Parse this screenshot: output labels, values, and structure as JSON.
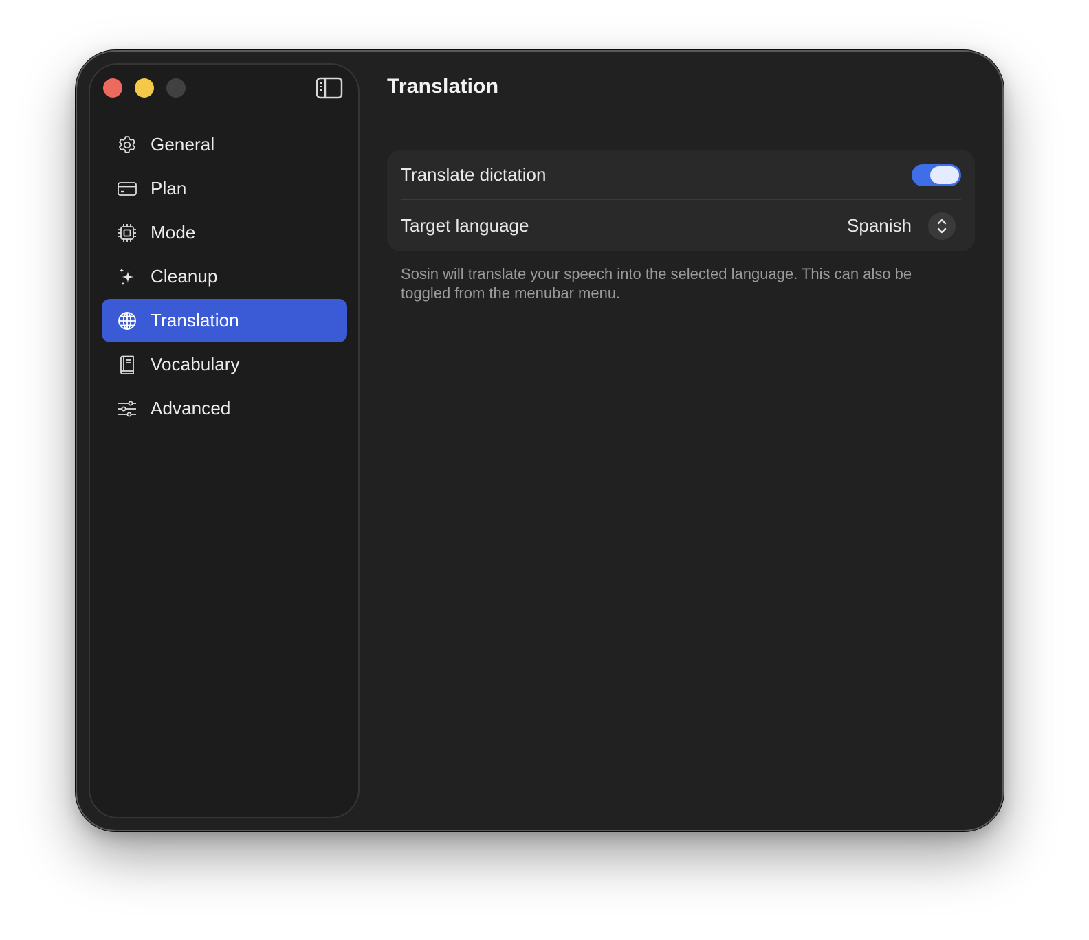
{
  "window": {
    "title": "Translation"
  },
  "sidebar": {
    "items": [
      {
        "label": "General",
        "icon": "gear-icon"
      },
      {
        "label": "Plan",
        "icon": "credit-card-icon"
      },
      {
        "label": "Mode",
        "icon": "cpu-chip-icon"
      },
      {
        "label": "Cleanup",
        "icon": "sparkles-icon"
      },
      {
        "label": "Translation",
        "icon": "globe-icon",
        "selected": true
      },
      {
        "label": "Vocabulary",
        "icon": "book-icon"
      },
      {
        "label": "Advanced",
        "icon": "sliders-icon"
      }
    ]
  },
  "settings": {
    "translate_label": "Translate dictation",
    "translate_enabled": true,
    "target_label": "Target language",
    "target_value": "Spanish",
    "help_text": "Sosin will translate your speech into the selected language. This can also be toggled from the menubar menu."
  },
  "colors": {
    "accent": "#3a5ad6",
    "switch_on": "#3e6ee8",
    "window_bg": "#212121",
    "sidebar_bg": "#1c1c1c"
  }
}
